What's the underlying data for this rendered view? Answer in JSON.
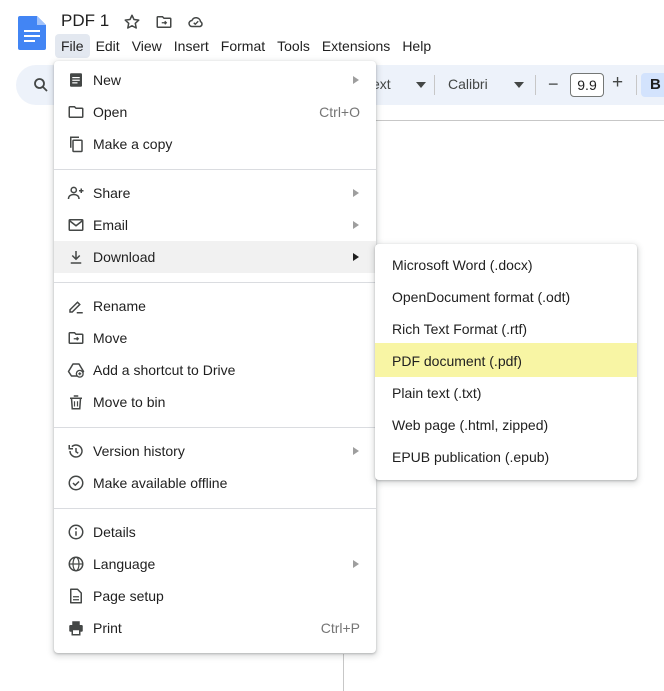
{
  "document": {
    "title": "PDF 1"
  },
  "menubar": [
    "File",
    "Edit",
    "View",
    "Insert",
    "Format",
    "Tools",
    "Extensions",
    "Help"
  ],
  "toolbar": {
    "style_text": "ext",
    "font": "Calibri",
    "font_size": "9.9",
    "minus": "−",
    "plus": "+",
    "bold": "B"
  },
  "file_menu": {
    "new": "New",
    "open": "Open",
    "open_shortcut": "Ctrl+O",
    "make_copy": "Make a copy",
    "share": "Share",
    "email": "Email",
    "download": "Download",
    "rename": "Rename",
    "move": "Move",
    "add_shortcut": "Add a shortcut to Drive",
    "move_to_bin": "Move to bin",
    "version_history": "Version history",
    "make_offline": "Make available offline",
    "details": "Details",
    "language": "Language",
    "page_setup": "Page setup",
    "print": "Print",
    "print_shortcut": "Ctrl+P"
  },
  "download_menu": [
    "Microsoft Word (.docx)",
    "OpenDocument format (.odt)",
    "Rich Text Format (.rtf)",
    "PDF document (.pdf)",
    "Plain text (.txt)",
    "Web page (.html, zipped)",
    "EPUB publication (.epub)"
  ],
  "colors": {
    "docs_blue": "#4285f4",
    "toolbar_bg": "#edf2fa",
    "highlight": "#f8f5a4",
    "active_menu": "#e3e8f0"
  }
}
